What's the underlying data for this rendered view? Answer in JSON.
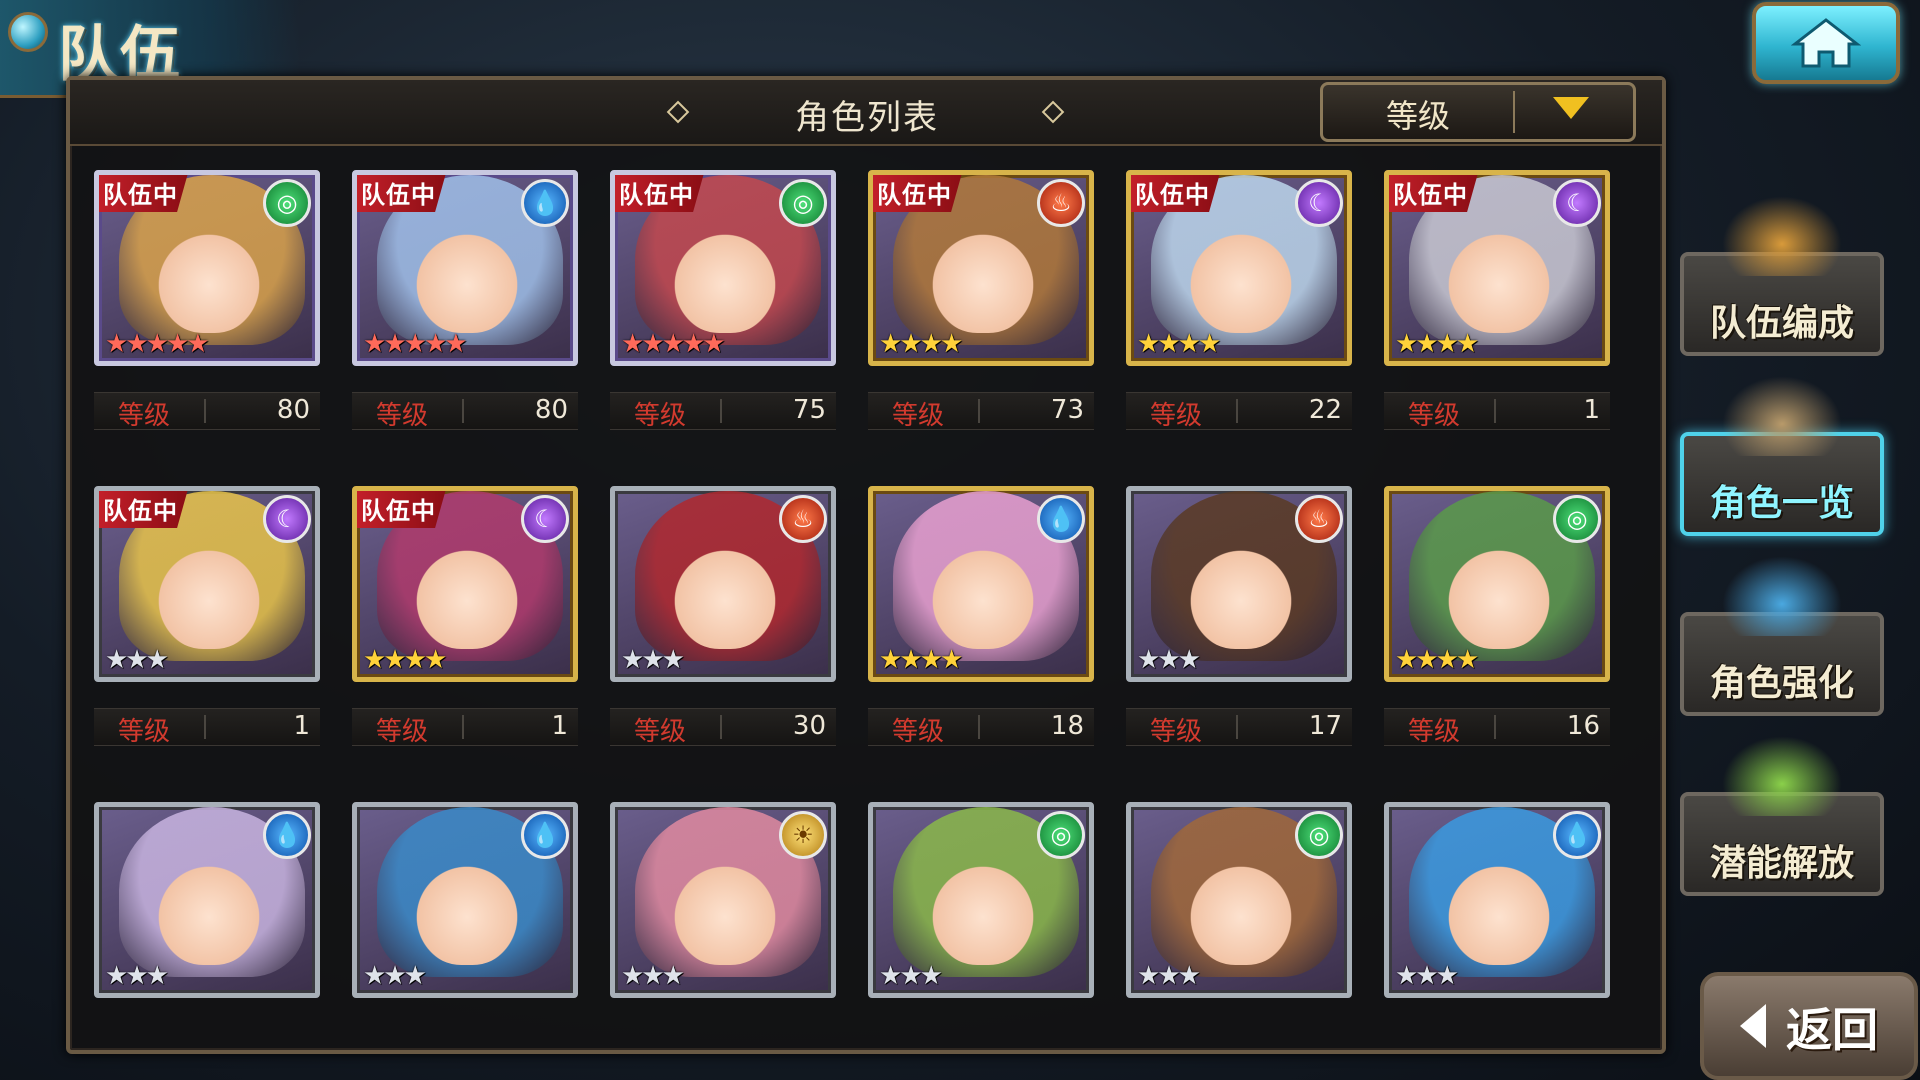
{
  "header": {
    "title": "队伍",
    "home_icon": "home-icon"
  },
  "panel": {
    "title": "角色列表",
    "sort_label": "等级",
    "sort_icon": "chevron-down-icon"
  },
  "level_label": "等级",
  "team_badge": "队伍中",
  "characters": [
    {
      "in_team": true,
      "element": "wind",
      "stars": 5,
      "frame": "rainbow",
      "level": "80",
      "hair": "#d9a24a"
    },
    {
      "in_team": true,
      "element": "water",
      "stars": 5,
      "frame": "rainbow",
      "level": "80",
      "hair": "#9fbfe8"
    },
    {
      "in_team": true,
      "element": "wind",
      "stars": 5,
      "frame": "rainbow",
      "level": "75",
      "hair": "#c2484e"
    },
    {
      "in_team": true,
      "element": "fire",
      "stars": 4,
      "frame": "gold",
      "level": "73",
      "hair": "#b0783a"
    },
    {
      "in_team": true,
      "element": "dark",
      "stars": 4,
      "frame": "gold",
      "level": "22",
      "hair": "#bcd6ec"
    },
    {
      "in_team": true,
      "element": "dark",
      "stars": 4,
      "frame": "gold",
      "level": "1",
      "hair": "#c8c8d2"
    },
    {
      "in_team": true,
      "element": "dark",
      "stars": 3,
      "frame": "silver",
      "level": "1",
      "hair": "#e8c44a"
    },
    {
      "in_team": true,
      "element": "dark",
      "stars": 4,
      "frame": "gold",
      "level": "1",
      "hair": "#b03a6c"
    },
    {
      "in_team": false,
      "element": "fire",
      "stars": 3,
      "frame": "silver",
      "level": "30",
      "hair": "#b0282e"
    },
    {
      "in_team": false,
      "element": "water",
      "stars": 4,
      "frame": "gold",
      "level": "18",
      "hair": "#e8a0d0"
    },
    {
      "in_team": false,
      "element": "fire",
      "stars": 3,
      "frame": "silver",
      "level": "17",
      "hair": "#5a3a24"
    },
    {
      "in_team": false,
      "element": "wind",
      "stars": 4,
      "frame": "gold",
      "level": "16",
      "hair": "#5a9a4a"
    },
    {
      "in_team": false,
      "element": "water",
      "stars": 3,
      "frame": "silver",
      "level": "",
      "hair": "#c8b4e0"
    },
    {
      "in_team": false,
      "element": "water",
      "stars": 3,
      "frame": "silver",
      "level": "",
      "hair": "#3a8ac8"
    },
    {
      "in_team": false,
      "element": "light",
      "stars": 3,
      "frame": "silver",
      "level": "",
      "hair": "#e08aa0"
    },
    {
      "in_team": false,
      "element": "wind",
      "stars": 3,
      "frame": "silver",
      "level": "",
      "hair": "#8ab84a"
    },
    {
      "in_team": false,
      "element": "wind",
      "stars": 3,
      "frame": "silver",
      "level": "",
      "hair": "#a0683a"
    },
    {
      "in_team": false,
      "element": "water",
      "stars": 3,
      "frame": "silver",
      "level": "",
      "hair": "#3a9ae0"
    }
  ],
  "side_menu": [
    {
      "label": "队伍编成",
      "icon": "team-members-icon",
      "active": false
    },
    {
      "label": "角色一览",
      "icon": "book-icon",
      "active": true
    },
    {
      "label": "角色强化",
      "icon": "enhance-icon",
      "active": false
    },
    {
      "label": "潜能解放",
      "icon": "potential-orb-icon",
      "active": false
    }
  ],
  "back_button": {
    "label": "返回",
    "icon": "back-arrow-icon"
  },
  "colors": {
    "accent_cyan": "#4fd2ea",
    "level_red": "#d23a2e",
    "team_badge_red": "#c4202a",
    "sort_arrow_gold": "#f0c020"
  }
}
